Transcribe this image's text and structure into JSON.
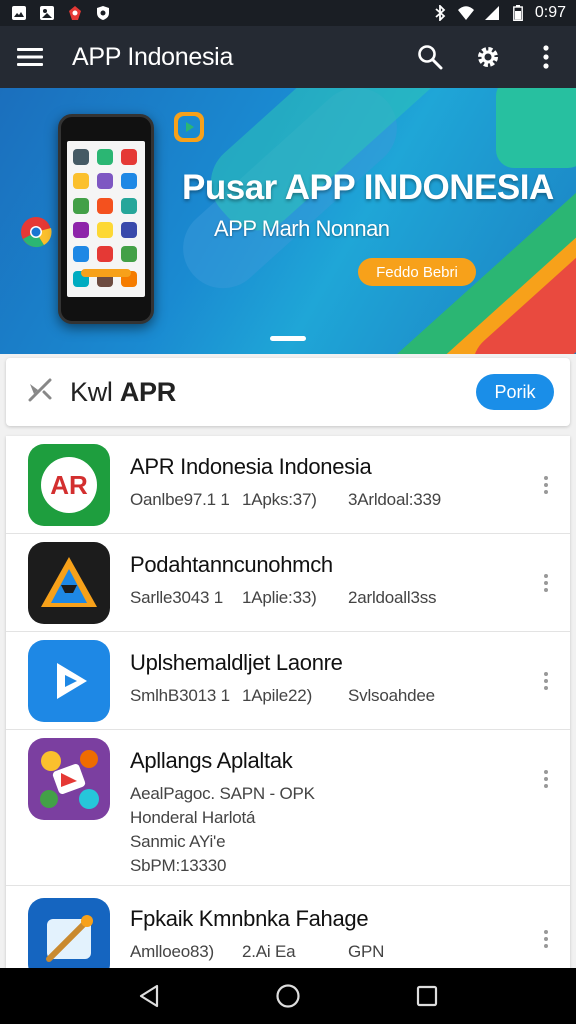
{
  "status_bar": {
    "time": "0:97",
    "icons": [
      "image-icon",
      "photo-icon",
      "game-icon",
      "shield-icon",
      "bluetooth-icon",
      "wifi-icon",
      "signal-icon",
      "battery-icon"
    ]
  },
  "app_bar": {
    "title": "APP Indonesia",
    "icons": [
      "menu-icon",
      "search-icon",
      "settings-icon",
      "more-vert-icon"
    ]
  },
  "banner": {
    "headline": "Pusar APP INDONESIA",
    "subheadline": "APP Marh Nonnan",
    "cta_label": "Feddo Bebri"
  },
  "search": {
    "placeholder_prefix": "Kwl",
    "placeholder_bold": "APR",
    "button_label": "Porik"
  },
  "apps": [
    {
      "name": "APR Indonesia Indonesia",
      "meta": [
        "Oanlbe97.1 1",
        "1Apks:37)",
        "3Arldoal:339"
      ]
    },
    {
      "name": "Podahtanncunohmch",
      "meta": [
        "Sarlle3043 1",
        "1Aplie:33)",
        "2arldoall3ss"
      ]
    },
    {
      "name": "Uplshemaldljet Laonre",
      "meta": [
        "SmlhB3013 1",
        "1Apile22)",
        "Svlsoahdee"
      ]
    },
    {
      "name": "Apllangs Aplaltak",
      "lines": [
        "AealPagoc. SAPN - OPK",
        "Honderal Harlotá",
        "Sanmic AYi'e",
        "SbPM:13330"
      ]
    },
    {
      "name": "Fpkaik Kmnbnka Fahage",
      "meta": [
        "Amlloeo83)",
        "2.Ai Ea",
        "GPN"
      ]
    }
  ],
  "nav_bar": {
    "icons": [
      "back-icon",
      "home-icon",
      "recents-icon"
    ]
  },
  "colors": {
    "app_bar": "#252a33",
    "accent_blue": "#1a8ee8",
    "cta_orange": "#f7a11a"
  }
}
